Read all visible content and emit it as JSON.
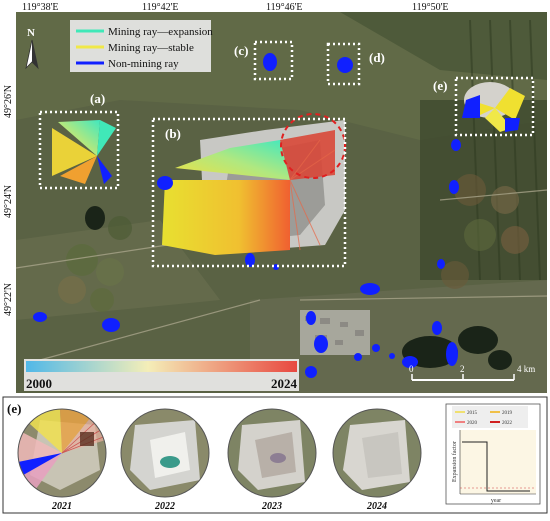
{
  "map": {
    "lon_labels": [
      "119°38'E",
      "119°42'E",
      "119°46'E",
      "119°50'E"
    ],
    "lat_labels": [
      "49°26'N",
      "49°24'N",
      "49°22'N"
    ],
    "north_label": "N",
    "legend": {
      "items": [
        {
          "label": "Mining ray—expansion",
          "color": "#40e8b8"
        },
        {
          "label": "Mining ray—stable",
          "color": "#f0e848"
        },
        {
          "label": "Non-mining ray",
          "color": "#1020ff"
        }
      ]
    },
    "panels": [
      "(a)",
      "(b)",
      "(c)",
      "(d)",
      "(e)"
    ],
    "colorbar": {
      "start": "2000",
      "end": "2024",
      "colors": [
        "#50b8e8",
        "#f4eeb8",
        "#e84840"
      ]
    },
    "scale_bar": {
      "ticks": [
        "0",
        "2",
        "4 km"
      ]
    }
  },
  "bottom": {
    "panel_label": "(e)",
    "years": [
      "2021",
      "2022",
      "2023",
      "2024"
    ],
    "chart": {
      "legend": [
        {
          "label": "2015",
          "color": "#f0e070"
        },
        {
          "label": "2019",
          "color": "#f0c048"
        },
        {
          "label": "2020",
          "color": "#f08080"
        },
        {
          "label": "2022",
          "color": "#d02020"
        }
      ],
      "ylabel": "Expansion factor",
      "xlabel": "year"
    }
  }
}
